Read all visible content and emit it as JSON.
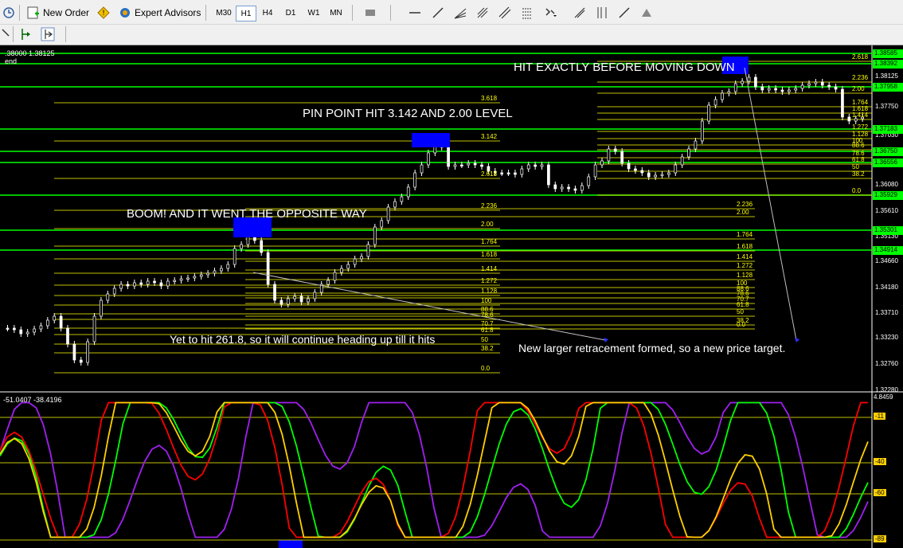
{
  "toolbar": {
    "new_order": "New Order",
    "expert_advisors": "Expert Advisors",
    "timeframes": [
      "M30",
      "H1",
      "H4",
      "D1",
      "W1",
      "MN"
    ],
    "active_timeframe": "H1"
  },
  "chart": {
    "header_left": ".38000 1.38125",
    "header_left2": "end",
    "annotations": {
      "hit_exactly": "HIT EXACTLY BEFORE MOVING DOWN",
      "pin_point": "PIN POINT HIT 3.142 AND 2.00 LEVEL",
      "boom": "BOOM! AND IT WENT THE OPPOSITE WAY",
      "yet_to_hit": "Yet to hit 261.8, so it will continue heading up till it hits",
      "new_larger": "New larger retracement formed, so a new price target."
    },
    "price_axis": [
      "1.38125",
      "1.37750",
      "1.37030",
      "1.36080",
      "1.35610",
      "1.35130",
      "1.34660",
      "1.34180",
      "1.33710",
      "1.33230",
      "1.32760",
      "1.32280"
    ],
    "green_levels": [
      "1.38585",
      "1.38392",
      "1.37958",
      "1.37183",
      "1.36750",
      "1.36556",
      "1.35929",
      "1.35301",
      "1.34914"
    ],
    "fib_left": [
      "3.618",
      "3.142",
      "2.618",
      "2.236",
      "2.00",
      "1.764",
      "1.618",
      "1.414",
      "1.272",
      "1.128",
      "100",
      "88.6",
      "78.6",
      "70.7",
      "61.8",
      "50",
      "38.2",
      "0.0"
    ],
    "fib_middle": [
      "2.236",
      "2.00",
      "1.764",
      "1.618",
      "1.414",
      "1.272",
      "1.128",
      "100",
      "88.6",
      "78.6",
      "70.7",
      "61.8",
      "50",
      "38.2",
      "0.0"
    ],
    "fib_right": [
      "2.618",
      "2.236",
      "2.00",
      "1.764",
      "1.618",
      "1.414",
      "1.272",
      "1.128",
      "100",
      "88.6",
      "78.6",
      "61.8",
      "50",
      "38.2",
      "0.0"
    ]
  },
  "indicator": {
    "label": "-51.0407 -38.4196",
    "axis": [
      "4.8459",
      "-11",
      "-40",
      "-60",
      "-89"
    ]
  },
  "colors": {
    "green_line": "#00ff00",
    "fib_line": "#ffff00",
    "blue_box": "#0000ff",
    "red": "#ff0000",
    "orange": "#ffd000",
    "purple": "#a020f0"
  }
}
